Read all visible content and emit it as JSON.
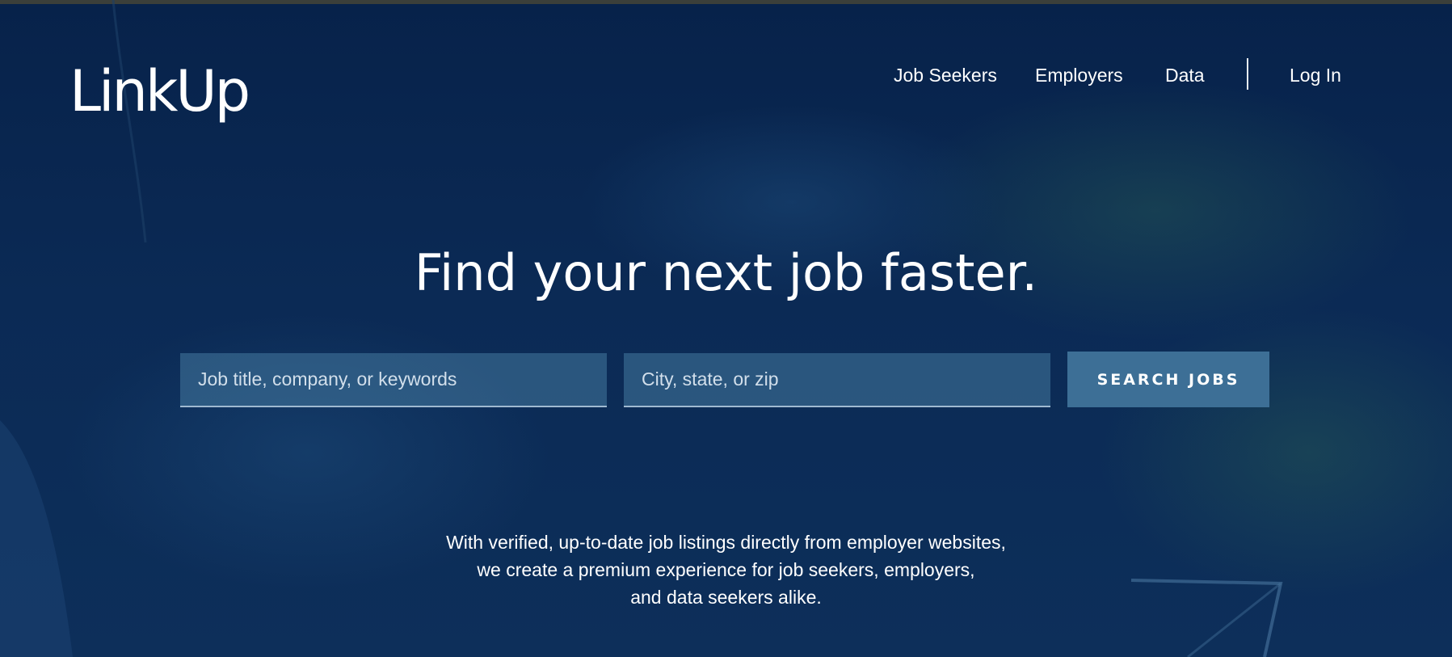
{
  "brand": {
    "logo_text": "LinkUp"
  },
  "nav": {
    "items": [
      {
        "label": "Job Seekers"
      },
      {
        "label": "Employers"
      },
      {
        "label": "Data"
      }
    ],
    "login_label": "Log In"
  },
  "hero": {
    "headline": "Find your next job faster.",
    "search": {
      "keywords_placeholder": "Job title, company, or keywords",
      "keywords_value": "",
      "location_placeholder": "City, state, or zip",
      "location_value": "",
      "button_label": "SEARCH JOBS"
    },
    "tagline_lines": [
      "With verified, up-to-date job listings directly from employer websites,",
      "we create a premium experience for job seekers, employers,",
      "and data seekers alike."
    ]
  },
  "colors": {
    "background": "#0b2a55",
    "field_background": "#3b6f93",
    "button_background": "#3d6f96",
    "text": "#ffffff"
  }
}
